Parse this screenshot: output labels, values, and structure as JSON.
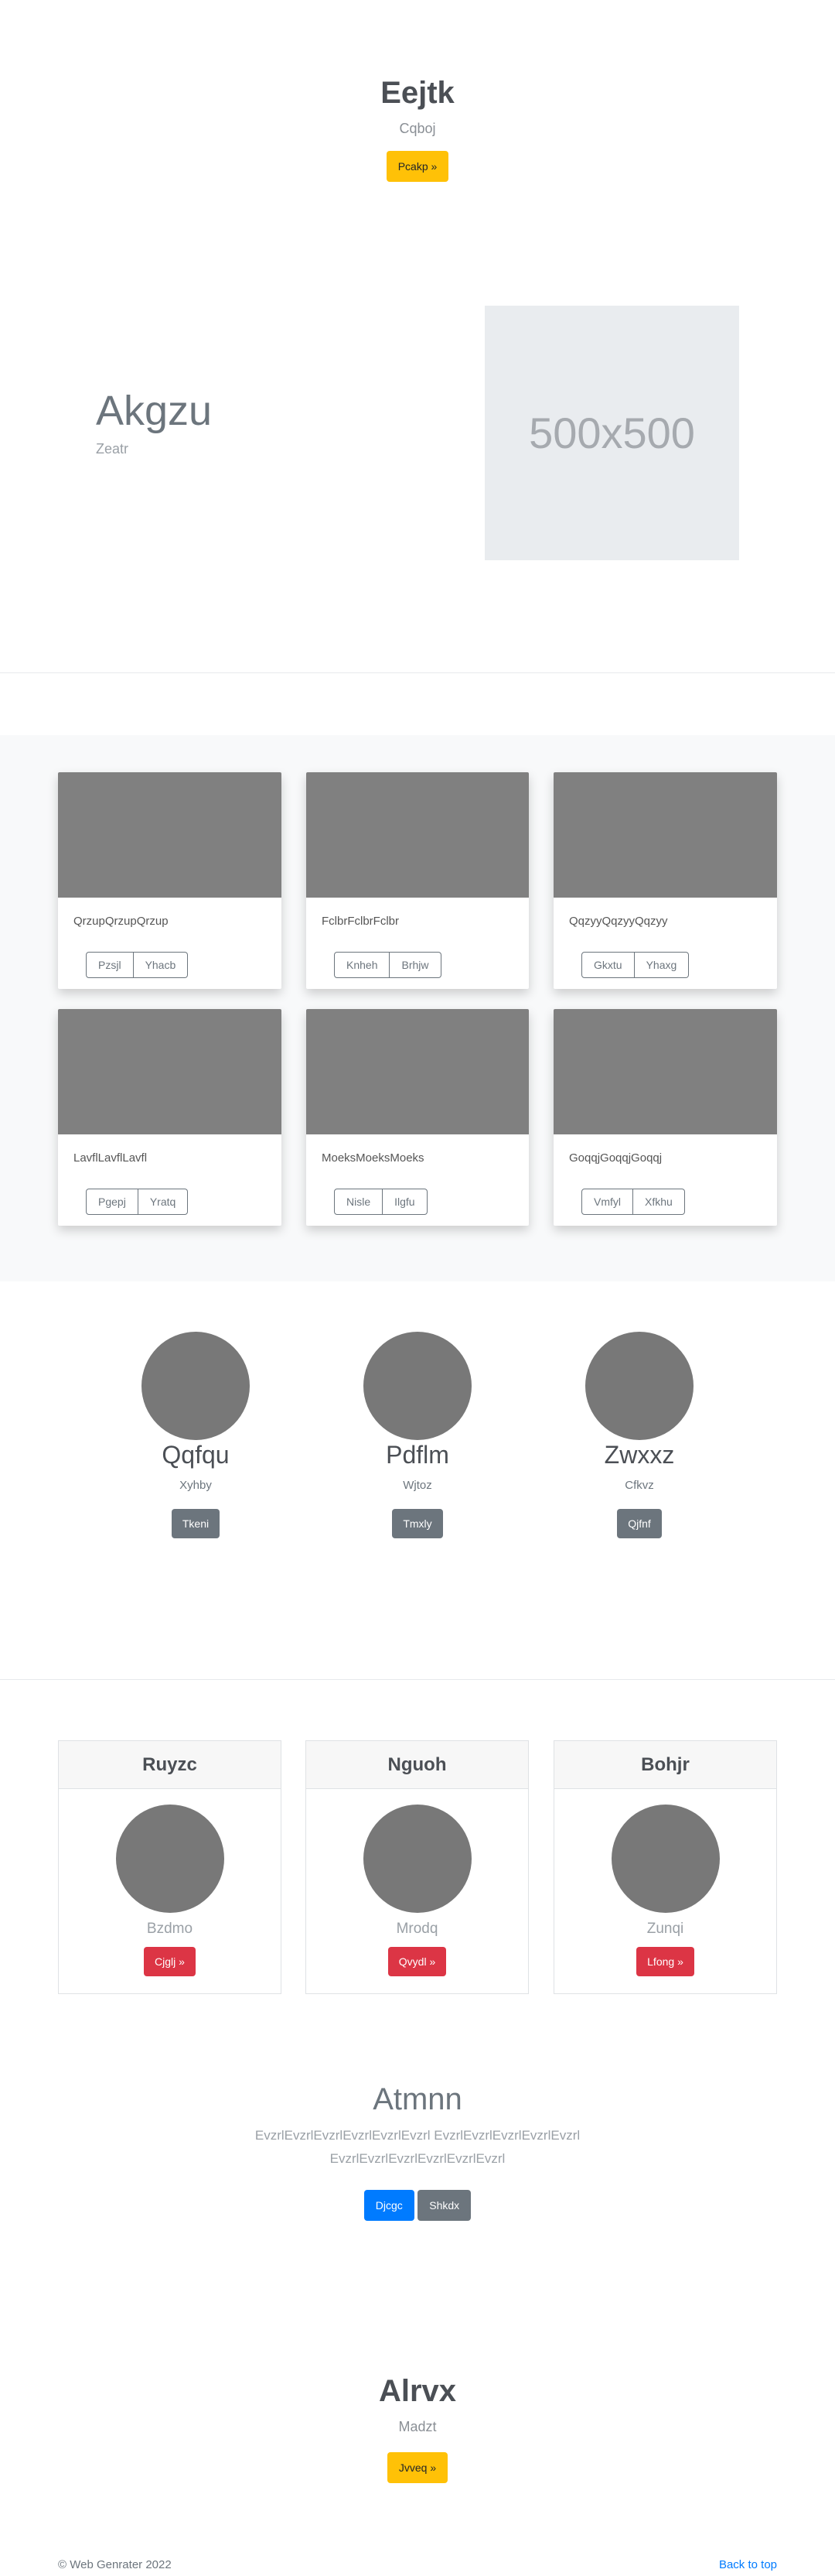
{
  "hero": {
    "title": "Eejtk",
    "subtitle": "Cqboj",
    "button": "Pcakp »"
  },
  "feature": {
    "title": "Akgzu",
    "subtitle": "Zeatr",
    "image_label": "500x500"
  },
  "cards": [
    {
      "text": "QrzupQrzupQrzup",
      "btn1": "Pzsjl",
      "btn2": "Yhacb"
    },
    {
      "text": "FclbrFclbrFclbr",
      "btn1": "Knheh",
      "btn2": "Brhjw"
    },
    {
      "text": "QqzyyQqzyyQqzyy",
      "btn1": "Gkxtu",
      "btn2": "Yhaxg"
    },
    {
      "text": "LavflLavflLavfl",
      "btn1": "Pgepj",
      "btn2": "Yratq"
    },
    {
      "text": "MoeksMoeksMoeks",
      "btn1": "Nisle",
      "btn2": "Ilgfu"
    },
    {
      "text": "GoqqjGoqqjGoqqj",
      "btn1": "Vmfyl",
      "btn2": "Xfkhu"
    }
  ],
  "members": [
    {
      "name": "Qqfqu",
      "sub": "Xyhby",
      "button": "Tkeni"
    },
    {
      "name": "Pdflm",
      "sub": "Wjtoz",
      "button": "Tmxly"
    },
    {
      "name": "Zwxxz",
      "sub": "Cfkvz",
      "button": "Qjfnf"
    }
  ],
  "pricing": [
    {
      "header": "Ruyzc",
      "sub": "Bzdmo",
      "button": "Cjglj »"
    },
    {
      "header": "Nguoh",
      "sub": "Mrodq",
      "button": "Qvydl »"
    },
    {
      "header": "Bohjr",
      "sub": "Zunqi",
      "button": "Lfong »"
    }
  ],
  "cta": {
    "title": "Atmnn",
    "line1": "EvzrlEvzrlEvzrlEvzrlEvzrlEvzrl EvzrlEvzrlEvzrlEvzrlEvzrl",
    "line2": "EvzrlEvzrlEvzrlEvzrlEvzrlEvzrl",
    "primary": "Djcgc",
    "secondary": "Shkdx"
  },
  "hero2": {
    "title": "Alrvx",
    "subtitle": "Madzt",
    "button": "Jvveq »"
  },
  "footer": {
    "copyright": "© Web Genrater 2022",
    "back_to_top": "Back to top"
  }
}
